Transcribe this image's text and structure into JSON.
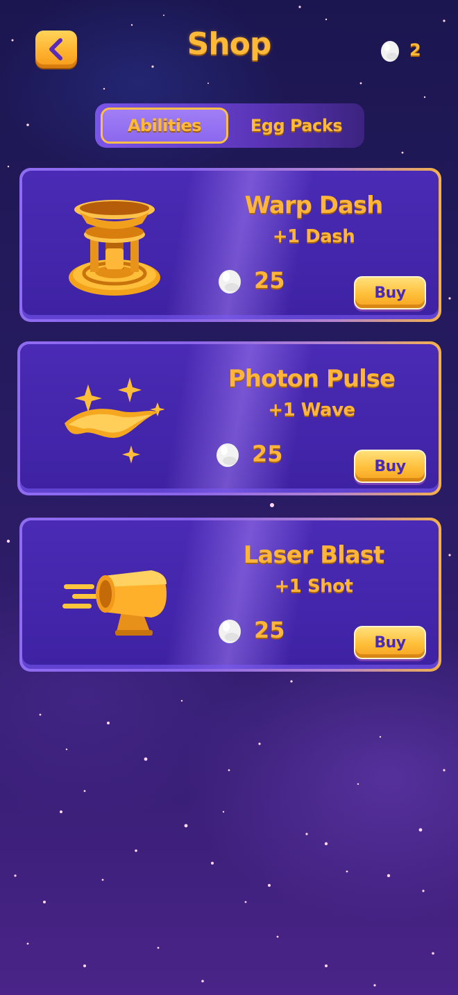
{
  "header": {
    "title": "Shop",
    "back_icon": "chevron-left-icon",
    "egg_icon": "egg-icon",
    "egg_count": "2"
  },
  "tabs": [
    {
      "label": "Abilities",
      "active": true
    },
    {
      "label": "Egg Packs",
      "active": false
    }
  ],
  "items": [
    {
      "name": "Warp Dash",
      "effect": "+1 Dash",
      "price": "25",
      "buy_label": "Buy",
      "icon": "warp-pad-icon"
    },
    {
      "name": "Photon Pulse",
      "effect": "+1 Wave",
      "price": "25",
      "buy_label": "Buy",
      "icon": "sparkle-wave-icon"
    },
    {
      "name": "Laser Blast",
      "effect": "+1 Shot",
      "price": "25",
      "buy_label": "Buy",
      "icon": "laser-gun-icon"
    }
  ],
  "colors": {
    "accent_gold": "#ffb938",
    "card_purple": "#4a2bb5",
    "background": "#231a5c"
  }
}
